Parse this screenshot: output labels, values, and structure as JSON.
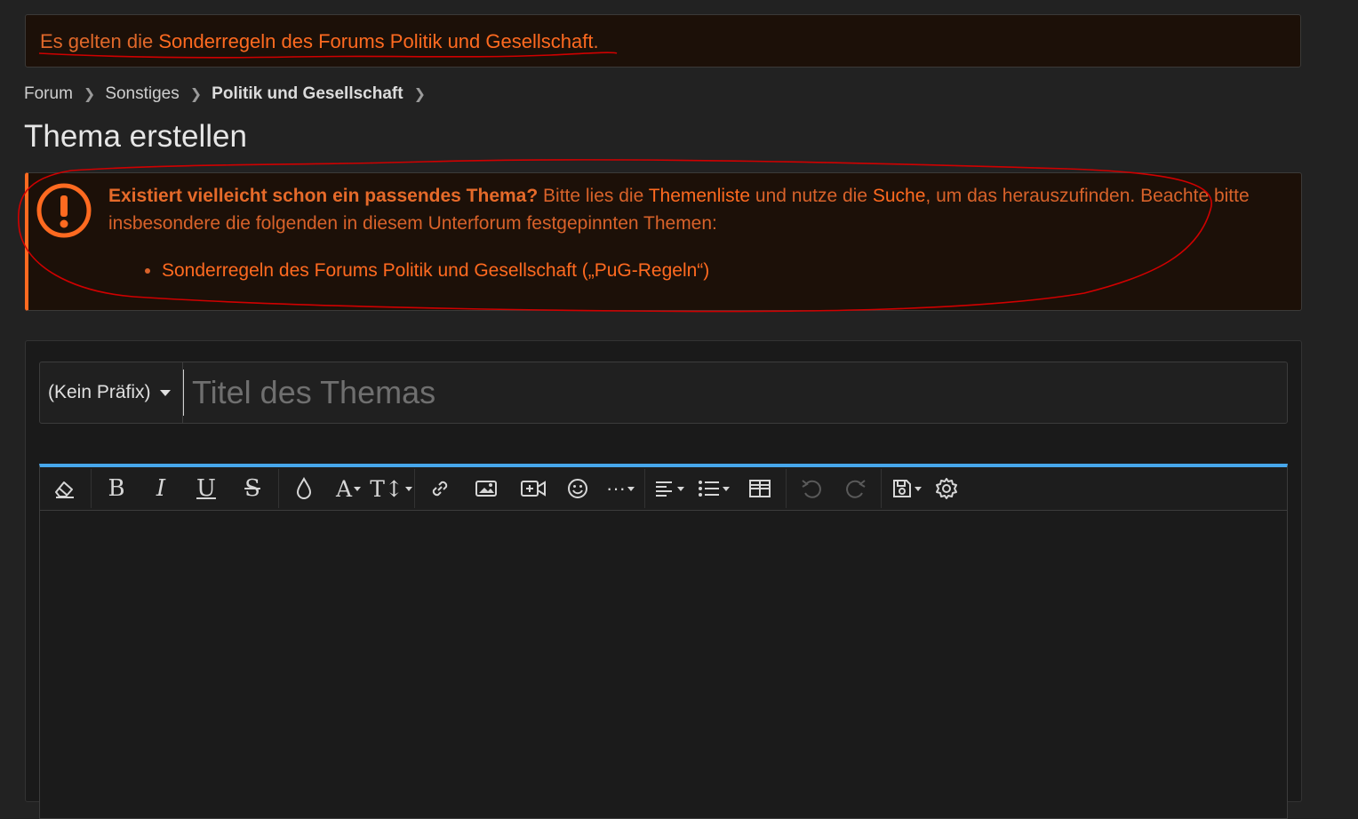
{
  "notice": {
    "prefix": "Es gelten die ",
    "link": "Sonderregeln des Forums Politik und Gesellschaft",
    "suffix": "."
  },
  "breadcrumb": {
    "items": [
      "Forum",
      "Sonstiges",
      "Politik und Gesellschaft"
    ]
  },
  "page_title": "Thema erstellen",
  "warning": {
    "icon": "exclamation-circle-icon",
    "bold": "Existiert vielleicht schon ein passendes Thema?",
    "t1": " Bitte lies die ",
    "link1": "Themenliste",
    "t2": " und nutze die ",
    "link2": "Suche",
    "t3": ", um das herauszufinden. Beachte bitte insbesondere die folgenden in diesem Unterforum festgepinnten Themen:",
    "pinned": [
      "Sonderregeln des Forums Politik und Gesellschaft („PuG-Regeln“)"
    ]
  },
  "form": {
    "prefix_select": "(Kein Präfix)",
    "title_placeholder": "Titel des Themas"
  },
  "toolbar": {
    "buttons": [
      "eraser-icon",
      "bold-icon",
      "italic-icon",
      "underline-icon",
      "strikethrough-icon",
      "color-drop-icon",
      "font-family-icon",
      "font-size-icon",
      "link-icon",
      "image-icon",
      "video-icon",
      "smiley-icon",
      "more-icon",
      "align-icon",
      "list-icon",
      "table-icon",
      "undo-icon",
      "redo-icon",
      "drafts-icon",
      "settings-icon"
    ]
  },
  "colors": {
    "accent": "#ff6a20",
    "editor_top_border": "#47a7eb",
    "annotation": "#d00000"
  }
}
